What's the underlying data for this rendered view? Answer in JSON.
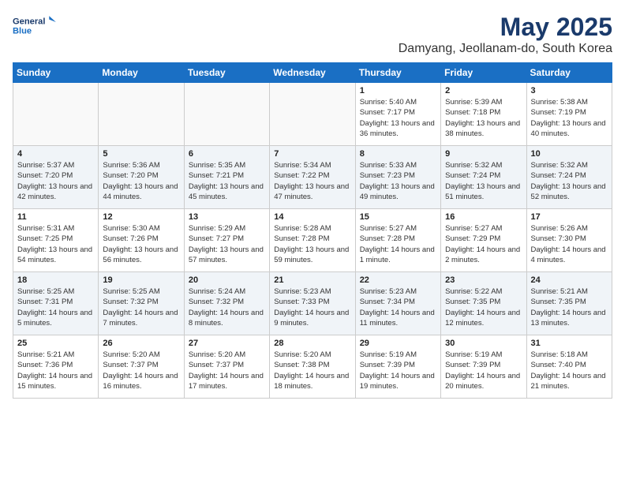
{
  "header": {
    "logo_line1": "General",
    "logo_line2": "Blue",
    "month_year": "May 2025",
    "location": "Damyang, Jeollanam-do, South Korea"
  },
  "weekdays": [
    "Sunday",
    "Monday",
    "Tuesday",
    "Wednesday",
    "Thursday",
    "Friday",
    "Saturday"
  ],
  "weeks": [
    [
      {
        "day": "",
        "empty": true
      },
      {
        "day": "",
        "empty": true
      },
      {
        "day": "",
        "empty": true
      },
      {
        "day": "",
        "empty": true
      },
      {
        "day": "1",
        "sunrise": "5:40 AM",
        "sunset": "7:17 PM",
        "daylight": "13 hours and 36 minutes."
      },
      {
        "day": "2",
        "sunrise": "5:39 AM",
        "sunset": "7:18 PM",
        "daylight": "13 hours and 38 minutes."
      },
      {
        "day": "3",
        "sunrise": "5:38 AM",
        "sunset": "7:19 PM",
        "daylight": "13 hours and 40 minutes."
      }
    ],
    [
      {
        "day": "4",
        "sunrise": "5:37 AM",
        "sunset": "7:20 PM",
        "daylight": "13 hours and 42 minutes."
      },
      {
        "day": "5",
        "sunrise": "5:36 AM",
        "sunset": "7:20 PM",
        "daylight": "13 hours and 44 minutes."
      },
      {
        "day": "6",
        "sunrise": "5:35 AM",
        "sunset": "7:21 PM",
        "daylight": "13 hours and 45 minutes."
      },
      {
        "day": "7",
        "sunrise": "5:34 AM",
        "sunset": "7:22 PM",
        "daylight": "13 hours and 47 minutes."
      },
      {
        "day": "8",
        "sunrise": "5:33 AM",
        "sunset": "7:23 PM",
        "daylight": "13 hours and 49 minutes."
      },
      {
        "day": "9",
        "sunrise": "5:32 AM",
        "sunset": "7:24 PM",
        "daylight": "13 hours and 51 minutes."
      },
      {
        "day": "10",
        "sunrise": "5:32 AM",
        "sunset": "7:24 PM",
        "daylight": "13 hours and 52 minutes."
      }
    ],
    [
      {
        "day": "11",
        "sunrise": "5:31 AM",
        "sunset": "7:25 PM",
        "daylight": "13 hours and 54 minutes."
      },
      {
        "day": "12",
        "sunrise": "5:30 AM",
        "sunset": "7:26 PM",
        "daylight": "13 hours and 56 minutes."
      },
      {
        "day": "13",
        "sunrise": "5:29 AM",
        "sunset": "7:27 PM",
        "daylight": "13 hours and 57 minutes."
      },
      {
        "day": "14",
        "sunrise": "5:28 AM",
        "sunset": "7:28 PM",
        "daylight": "13 hours and 59 minutes."
      },
      {
        "day": "15",
        "sunrise": "5:27 AM",
        "sunset": "7:28 PM",
        "daylight": "14 hours and 1 minute."
      },
      {
        "day": "16",
        "sunrise": "5:27 AM",
        "sunset": "7:29 PM",
        "daylight": "14 hours and 2 minutes."
      },
      {
        "day": "17",
        "sunrise": "5:26 AM",
        "sunset": "7:30 PM",
        "daylight": "14 hours and 4 minutes."
      }
    ],
    [
      {
        "day": "18",
        "sunrise": "5:25 AM",
        "sunset": "7:31 PM",
        "daylight": "14 hours and 5 minutes."
      },
      {
        "day": "19",
        "sunrise": "5:25 AM",
        "sunset": "7:32 PM",
        "daylight": "14 hours and 7 minutes."
      },
      {
        "day": "20",
        "sunrise": "5:24 AM",
        "sunset": "7:32 PM",
        "daylight": "14 hours and 8 minutes."
      },
      {
        "day": "21",
        "sunrise": "5:23 AM",
        "sunset": "7:33 PM",
        "daylight": "14 hours and 9 minutes."
      },
      {
        "day": "22",
        "sunrise": "5:23 AM",
        "sunset": "7:34 PM",
        "daylight": "14 hours and 11 minutes."
      },
      {
        "day": "23",
        "sunrise": "5:22 AM",
        "sunset": "7:35 PM",
        "daylight": "14 hours and 12 minutes."
      },
      {
        "day": "24",
        "sunrise": "5:21 AM",
        "sunset": "7:35 PM",
        "daylight": "14 hours and 13 minutes."
      }
    ],
    [
      {
        "day": "25",
        "sunrise": "5:21 AM",
        "sunset": "7:36 PM",
        "daylight": "14 hours and 15 minutes."
      },
      {
        "day": "26",
        "sunrise": "5:20 AM",
        "sunset": "7:37 PM",
        "daylight": "14 hours and 16 minutes."
      },
      {
        "day": "27",
        "sunrise": "5:20 AM",
        "sunset": "7:37 PM",
        "daylight": "14 hours and 17 minutes."
      },
      {
        "day": "28",
        "sunrise": "5:20 AM",
        "sunset": "7:38 PM",
        "daylight": "14 hours and 18 minutes."
      },
      {
        "day": "29",
        "sunrise": "5:19 AM",
        "sunset": "7:39 PM",
        "daylight": "14 hours and 19 minutes."
      },
      {
        "day": "30",
        "sunrise": "5:19 AM",
        "sunset": "7:39 PM",
        "daylight": "14 hours and 20 minutes."
      },
      {
        "day": "31",
        "sunrise": "5:18 AM",
        "sunset": "7:40 PM",
        "daylight": "14 hours and 21 minutes."
      }
    ]
  ]
}
